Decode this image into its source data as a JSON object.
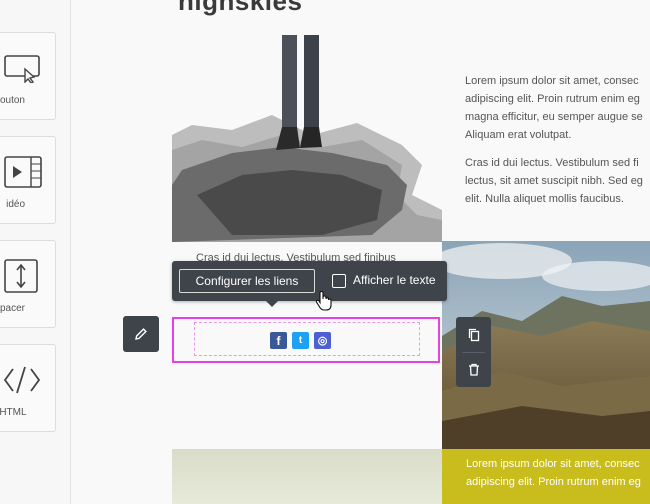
{
  "sidebar": {
    "items": [
      {
        "label": "outon",
        "icon": "cursor-click-icon"
      },
      {
        "label": "idéo",
        "icon": "video-icon"
      },
      {
        "label": "pacer",
        "icon": "spacer-icon"
      },
      {
        "label": "e HTML",
        "icon": "code-icon"
      }
    ]
  },
  "page": {
    "title": "highskies",
    "text1": {
      "p1": [
        "Lorem ipsum dolor sit amet, consec",
        "adipiscing elit. Proin rutrum enim eg",
        "magna efficitur, eu semper augue se",
        "Aliquam erat volutpat."
      ],
      "p2": [
        "Cras id dui lectus. Vestibulum sed fi",
        "lectus, sit amet suscipit nibh. Sed eg",
        "elit. Nulla aliquet mollis faucibus."
      ]
    },
    "caption": "Cras id dui lectus. Vestibulum sed finibus",
    "yellow_text": [
      "Lorem ipsum dolor sit amet, consec",
      "adipiscing elit. Proin rutrum enim eg"
    ]
  },
  "toolbar": {
    "configure_label": "Configurer les liens",
    "show_text_label": "Afficher le texte",
    "show_text_checked": false
  },
  "social": {
    "icons": [
      {
        "name": "facebook-icon",
        "glyph": "f",
        "color": "#3b5998"
      },
      {
        "name": "twitter-icon",
        "glyph": "t",
        "color": "#1da1f2"
      },
      {
        "name": "instagram-icon",
        "glyph": "◎",
        "color": "#4d5fd1"
      }
    ]
  },
  "colors": {
    "selection": "#e640e6",
    "toolbar": "#3f444a",
    "yellow": "#c9bd1e"
  }
}
